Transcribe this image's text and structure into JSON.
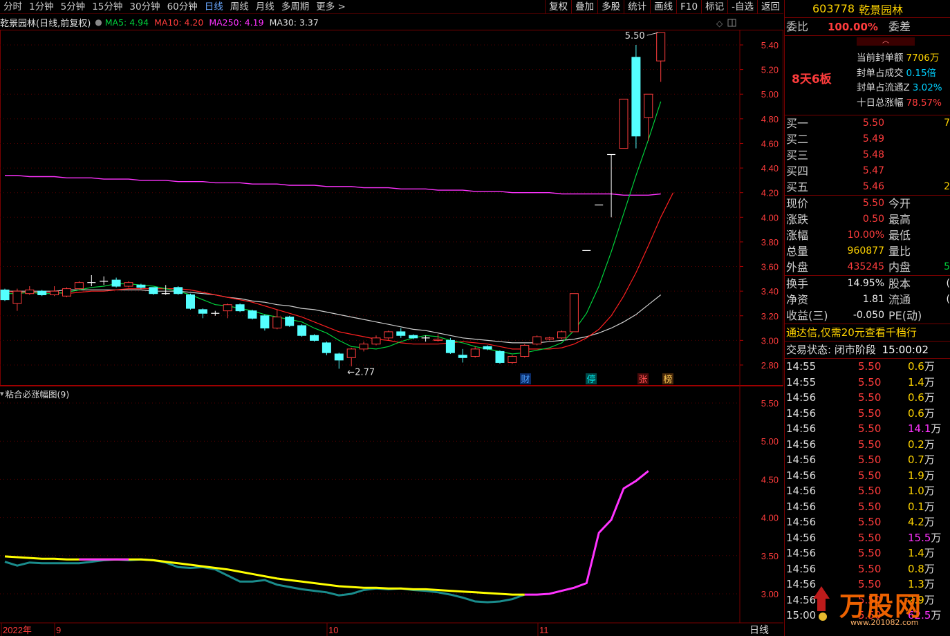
{
  "toolbar": {
    "periods": [
      "分时",
      "1分钟",
      "5分钟",
      "15分钟",
      "30分钟",
      "60分钟",
      "日线",
      "周线",
      "月线",
      "多周期",
      "更多 >"
    ],
    "active_period": "日线",
    "buttons": [
      "复权",
      "叠加",
      "多股",
      "统计",
      "画线",
      "F10",
      "标记",
      "-自选",
      "返回"
    ]
  },
  "main_chart": {
    "title": "乾景园林(日线,前复权)",
    "ma_labels": [
      {
        "text": "MA5: 4.94",
        "color": "#00d23c"
      },
      {
        "text": "MA10: 4.20",
        "color": "#ff3c3c"
      },
      {
        "text": "MA250: 4.19",
        "color": "#ff33ff"
      },
      {
        "text": "MA30: 3.37",
        "color": "#dddddd"
      }
    ],
    "y_ticks": [
      "5.40",
      "5.20",
      "5.00",
      "4.80",
      "4.60",
      "4.40",
      "4.20",
      "4.00",
      "3.80",
      "3.60",
      "3.40",
      "3.20",
      "3.00",
      "2.80"
    ],
    "high_label": "5.50",
    "low_label": "2.77",
    "event_tags": [
      {
        "text": "财",
        "color": "#4aa0ff",
        "bg": "#0a2a66"
      },
      {
        "text": "停",
        "color": "#00e0e0",
        "bg": "#004a4a"
      },
      {
        "text": "张",
        "color": "#ff5050",
        "bg": "#4a0a0a"
      },
      {
        "text": "榜",
        "color": "#ffcc55",
        "bg": "#4a2a0a"
      }
    ]
  },
  "sub_chart": {
    "title": "粘合必涨幅图(9)",
    "y_ticks": [
      "5.50",
      "5.00",
      "4.50",
      "4.00",
      "3.50",
      "3.00"
    ],
    "x_labels": [
      "2022年",
      "9",
      "10",
      "11"
    ],
    "period_label": "日线"
  },
  "candles": [
    {
      "o": 3.41,
      "c": 3.33,
      "h": 3.42,
      "l": 3.32
    },
    {
      "o": 3.3,
      "c": 3.4,
      "h": 3.42,
      "l": 3.24
    },
    {
      "o": 3.38,
      "c": 3.41,
      "h": 3.44,
      "l": 3.37
    },
    {
      "o": 3.4,
      "c": 3.37,
      "h": 3.41,
      "l": 3.36
    },
    {
      "o": 3.37,
      "c": 3.4,
      "h": 3.44,
      "l": 3.36
    },
    {
      "o": 3.36,
      "c": 3.42,
      "h": 3.43,
      "l": 3.35
    },
    {
      "o": 3.42,
      "c": 3.47,
      "h": 3.48,
      "l": 3.41
    },
    {
      "o": 3.47,
      "c": 3.47,
      "h": 3.53,
      "l": 3.44
    },
    {
      "o": 3.48,
      "c": 3.48,
      "h": 3.52,
      "l": 3.45
    },
    {
      "o": 3.49,
      "c": 3.44,
      "h": 3.51,
      "l": 3.43
    },
    {
      "o": 3.44,
      "c": 3.47,
      "h": 3.48,
      "l": 3.43
    },
    {
      "o": 3.45,
      "c": 3.43,
      "h": 3.46,
      "l": 3.42
    },
    {
      "o": 3.43,
      "c": 3.38,
      "h": 3.43,
      "l": 3.37
    },
    {
      "o": 3.38,
      "c": 3.38,
      "h": 3.45,
      "l": 3.37
    },
    {
      "o": 3.43,
      "c": 3.38,
      "h": 3.44,
      "l": 3.37
    },
    {
      "o": 3.37,
      "c": 3.26,
      "h": 3.38,
      "l": 3.25
    },
    {
      "o": 3.25,
      "c": 3.22,
      "h": 3.26,
      "l": 3.18
    },
    {
      "o": 3.22,
      "c": 3.22,
      "h": 3.24,
      "l": 3.2
    },
    {
      "o": 3.24,
      "c": 3.29,
      "h": 3.3,
      "l": 3.18
    },
    {
      "o": 3.29,
      "c": 3.24,
      "h": 3.3,
      "l": 3.23
    },
    {
      "o": 3.24,
      "c": 3.18,
      "h": 3.25,
      "l": 3.17
    },
    {
      "o": 3.2,
      "c": 3.1,
      "h": 3.21,
      "l": 3.08
    },
    {
      "o": 3.1,
      "c": 3.19,
      "h": 3.25,
      "l": 3.09
    },
    {
      "o": 3.19,
      "c": 3.12,
      "h": 3.2,
      "l": 3.11
    },
    {
      "o": 3.12,
      "c": 3.04,
      "h": 3.13,
      "l": 3.03
    },
    {
      "o": 3.04,
      "c": 3.0,
      "h": 3.05,
      "l": 2.99
    },
    {
      "o": 2.98,
      "c": 2.9,
      "h": 2.99,
      "l": 2.88
    },
    {
      "o": 2.89,
      "c": 2.84,
      "h": 2.9,
      "l": 2.77
    },
    {
      "o": 2.86,
      "c": 2.93,
      "h": 2.94,
      "l": 2.79
    },
    {
      "o": 2.93,
      "c": 2.97,
      "h": 2.99,
      "l": 2.91
    },
    {
      "o": 2.97,
      "c": 3.02,
      "h": 3.04,
      "l": 2.96
    },
    {
      "o": 3.02,
      "c": 3.07,
      "h": 3.08,
      "l": 3.0
    },
    {
      "o": 3.07,
      "c": 3.04,
      "h": 3.1,
      "l": 3.02
    },
    {
      "o": 3.04,
      "c": 3.02,
      "h": 3.05,
      "l": 3.01
    },
    {
      "o": 3.02,
      "c": 3.02,
      "h": 3.04,
      "l": 2.99
    },
    {
      "o": 3.0,
      "c": 3.01,
      "h": 3.05,
      "l": 2.99
    },
    {
      "o": 3.0,
      "c": 2.9,
      "h": 3.02,
      "l": 2.89
    },
    {
      "o": 2.88,
      "c": 2.86,
      "h": 2.93,
      "l": 2.82
    },
    {
      "o": 2.87,
      "c": 2.93,
      "h": 2.95,
      "l": 2.86
    },
    {
      "o": 2.95,
      "c": 2.93,
      "h": 2.96,
      "l": 2.92
    },
    {
      "o": 2.91,
      "c": 2.82,
      "h": 2.92,
      "l": 2.81
    },
    {
      "o": 2.82,
      "c": 2.87,
      "h": 2.88,
      "l": 2.81
    },
    {
      "o": 2.87,
      "c": 2.96,
      "h": 2.97,
      "l": 2.86
    },
    {
      "o": 2.97,
      "c": 3.03,
      "h": 3.04,
      "l": 2.96
    },
    {
      "o": 3.01,
      "c": 3.02,
      "h": 3.03,
      "l": 3.0
    },
    {
      "o": 3.02,
      "c": 3.07,
      "h": 3.08,
      "l": 3.01
    },
    {
      "o": 3.07,
      "c": 3.38,
      "h": 3.38,
      "l": 3.07
    },
    {
      "o": 3.73,
      "c": 3.73,
      "h": 3.73,
      "l": 3.73
    },
    {
      "o": 4.1,
      "c": 4.1,
      "h": 4.1,
      "l": 4.1
    },
    {
      "o": 4.51,
      "c": 4.51,
      "h": 4.51,
      "l": 4.0
    },
    {
      "o": 4.56,
      "c": 4.96,
      "h": 4.96,
      "l": 4.56
    },
    {
      "o": 5.3,
      "c": 4.66,
      "h": 5.4,
      "l": 4.56
    },
    {
      "o": 4.81,
      "c": 5.0,
      "h": 5.0,
      "l": 4.62
    },
    {
      "o": 5.27,
      "c": 5.5,
      "h": 5.5,
      "l": 5.1
    }
  ],
  "ma_lines": {
    "ma5": [
      3.38,
      3.38,
      3.39,
      3.38,
      3.38,
      3.39,
      3.41,
      3.43,
      3.44,
      3.46,
      3.46,
      3.45,
      3.44,
      3.42,
      3.4,
      3.37,
      3.33,
      3.29,
      3.28,
      3.26,
      3.24,
      3.21,
      3.19,
      3.17,
      3.15,
      3.1,
      3.06,
      3.0,
      2.95,
      2.94,
      2.93,
      2.95,
      2.99,
      3.02,
      3.04,
      3.03,
      3.0,
      2.98,
      2.95,
      2.93,
      2.91,
      2.89,
      2.9,
      2.92,
      2.94,
      2.98,
      3.08,
      3.22,
      3.44,
      3.72,
      4.03,
      4.34,
      4.63,
      4.94
    ],
    "ma10": [
      3.4,
      3.39,
      3.39,
      3.39,
      3.39,
      3.38,
      3.39,
      3.4,
      3.4,
      3.41,
      3.42,
      3.42,
      3.42,
      3.42,
      3.42,
      3.41,
      3.39,
      3.37,
      3.35,
      3.33,
      3.31,
      3.28,
      3.25,
      3.22,
      3.19,
      3.15,
      3.11,
      3.07,
      3.05,
      3.03,
      3.01,
      3.0,
      2.98,
      2.97,
      2.97,
      2.97,
      2.98,
      2.99,
      2.98,
      2.97,
      2.95,
      2.93,
      2.93,
      2.93,
      2.93,
      2.94,
      2.97,
      3.02,
      3.09,
      3.2,
      3.36,
      3.55,
      3.77,
      4.0,
      4.2
    ],
    "ma30": [
      3.4,
      3.4,
      3.4,
      3.4,
      3.4,
      3.41,
      3.41,
      3.41,
      3.41,
      3.41,
      3.41,
      3.41,
      3.4,
      3.4,
      3.4,
      3.39,
      3.38,
      3.37,
      3.35,
      3.34,
      3.32,
      3.31,
      3.29,
      3.28,
      3.26,
      3.25,
      3.23,
      3.21,
      3.19,
      3.17,
      3.15,
      3.13,
      3.11,
      3.09,
      3.08,
      3.06,
      3.04,
      3.02,
      3.01,
      3.0,
      2.99,
      2.98,
      2.98,
      2.98,
      2.99,
      3.0,
      3.01,
      3.03,
      3.06,
      3.1,
      3.15,
      3.21,
      3.29,
      3.37
    ],
    "ma250": [
      4.34,
      4.34,
      4.33,
      4.33,
      4.33,
      4.32,
      4.32,
      4.32,
      4.31,
      4.31,
      4.31,
      4.3,
      4.3,
      4.3,
      4.29,
      4.29,
      4.29,
      4.28,
      4.28,
      4.28,
      4.27,
      4.27,
      4.27,
      4.26,
      4.26,
      4.26,
      4.25,
      4.25,
      4.25,
      4.24,
      4.24,
      4.24,
      4.23,
      4.23,
      4.23,
      4.22,
      4.22,
      4.22,
      4.21,
      4.21,
      4.21,
      4.2,
      4.2,
      4.2,
      4.2,
      4.19,
      4.19,
      4.19,
      4.19,
      4.19,
      4.18,
      4.18,
      4.18,
      4.19
    ]
  },
  "indicator": {
    "yellow": [
      3.49,
      3.48,
      3.47,
      3.46,
      3.46,
      3.45,
      3.45,
      3.45,
      3.45,
      3.45,
      3.45,
      3.45,
      3.44,
      3.42,
      3.4,
      3.38,
      3.36,
      3.34,
      3.32,
      3.29,
      3.26,
      3.23,
      3.2,
      3.18,
      3.16,
      3.14,
      3.12,
      3.1,
      3.09,
      3.08,
      3.08,
      3.07,
      3.07,
      3.06,
      3.06,
      3.05,
      3.04,
      3.03,
      3.02,
      3.01,
      3.0,
      2.99,
      2.99
    ],
    "teal": [
      3.42,
      3.37,
      3.41,
      3.4,
      3.4,
      3.4,
      3.4,
      3.42,
      3.44,
      3.45,
      3.44,
      3.45,
      3.44,
      3.41,
      3.35,
      3.34,
      3.35,
      3.32,
      3.24,
      3.16,
      3.16,
      3.18,
      3.12,
      3.09,
      3.06,
      3.04,
      3.02,
      2.98,
      3.0,
      3.05,
      3.07,
      3.06,
      3.07,
      3.05,
      3.04,
      3.02,
      2.99,
      2.95,
      2.9,
      2.89,
      2.9,
      2.93,
      2.99
    ],
    "magenta_start": 42,
    "magenta": [
      2.99,
      2.99,
      3.0,
      3.04,
      3.08,
      3.14,
      3.8,
      3.97,
      4.38,
      4.48,
      4.61
    ]
  },
  "panel": {
    "code": "603778",
    "name": "乾景园林",
    "weibi_label": "委比",
    "weibi_value": "100.00%",
    "weicha_label": "委差",
    "streak": "8天6板",
    "seal": [
      {
        "label": "当前封单额",
        "value": "7706万"
      },
      {
        "label": "封单占成交",
        "value": "0.15倍"
      },
      {
        "label": "封单占流通Z",
        "value": "3.02%"
      },
      {
        "label": "十日总涨幅",
        "value": "78.57%"
      }
    ],
    "bids": [
      {
        "label": "买一",
        "price": "5.50",
        "vol": "7"
      },
      {
        "label": "买二",
        "price": "5.49",
        "vol": ""
      },
      {
        "label": "买三",
        "price": "5.48",
        "vol": ""
      },
      {
        "label": "买四",
        "price": "5.47",
        "vol": ""
      },
      {
        "label": "买五",
        "price": "5.46",
        "vol": "2"
      }
    ],
    "quote": [
      {
        "l1": "现价",
        "v1": "5.50",
        "c1": "red",
        "l2": "今开",
        "v2": ""
      },
      {
        "l1": "涨跌",
        "v1": "0.50",
        "c1": "red",
        "l2": "最高",
        "v2": ""
      },
      {
        "l1": "涨幅",
        "v1": "10.00%",
        "c1": "red",
        "l2": "最低",
        "v2": ""
      },
      {
        "l1": "总量",
        "v1": "960877",
        "c1": "yellow",
        "l2": "量比",
        "v2": ""
      },
      {
        "l1": "外盘",
        "v1": "435245",
        "c1": "red",
        "l2": "内盘",
        "v2": "5"
      }
    ],
    "stats": [
      {
        "l1": "换手",
        "v1": "14.95%",
        "l2": "股本",
        "v2": "("
      },
      {
        "l1": "净资",
        "v1": "1.81",
        "l2": "流通",
        "v2": "("
      },
      {
        "l1": "收益(三)",
        "v1": "-0.050",
        "l2": "PE(动)",
        "v2": ""
      }
    ],
    "promo": "通达信,仅需20元查看千档行",
    "trade_status_label": "交易状态:",
    "trade_status_value": "闭市阶段",
    "trade_time": "15:00:02",
    "ticks": [
      {
        "t": "14:55",
        "p": "5.50",
        "v": "0.6",
        "u": "万"
      },
      {
        "t": "14:55",
        "p": "5.50",
        "v": "1.4",
        "u": "万"
      },
      {
        "t": "14:56",
        "p": "5.50",
        "v": "0.6",
        "u": "万"
      },
      {
        "t": "14:56",
        "p": "5.50",
        "v": "0.6",
        "u": "万"
      },
      {
        "t": "14:56",
        "p": "5.50",
        "v": "14.1",
        "u": "万"
      },
      {
        "t": "14:56",
        "p": "5.50",
        "v": "0.2",
        "u": "万"
      },
      {
        "t": "14:56",
        "p": "5.50",
        "v": "0.7",
        "u": "万"
      },
      {
        "t": "14:56",
        "p": "5.50",
        "v": "1.9",
        "u": "万"
      },
      {
        "t": "14:56",
        "p": "5.50",
        "v": "1.0",
        "u": "万"
      },
      {
        "t": "14:56",
        "p": "5.50",
        "v": "0.1",
        "u": "万"
      },
      {
        "t": "14:56",
        "p": "5.50",
        "v": "4.2",
        "u": "万"
      },
      {
        "t": "14:56",
        "p": "5.50",
        "v": "15.5",
        "u": "万"
      },
      {
        "t": "14:56",
        "p": "5.50",
        "v": "1.4",
        "u": "万"
      },
      {
        "t": "14:56",
        "p": "5.50",
        "v": "0.8",
        "u": "万"
      },
      {
        "t": "14:56",
        "p": "5.50",
        "v": "1.3",
        "u": "万"
      },
      {
        "t": "14:56",
        "p": "5.50",
        "v": "2.9",
        "u": "万"
      },
      {
        "t": "15:00",
        "p": "5.50",
        "v": "62.5",
        "u": "万"
      }
    ]
  },
  "watermark": {
    "brand": "万股网",
    "url": "www.201082.com"
  },
  "colors": {
    "up": "#ff3c3c",
    "down": "#54ffff",
    "grid": "#5a0000",
    "axis_text": "#ff3c3c"
  }
}
